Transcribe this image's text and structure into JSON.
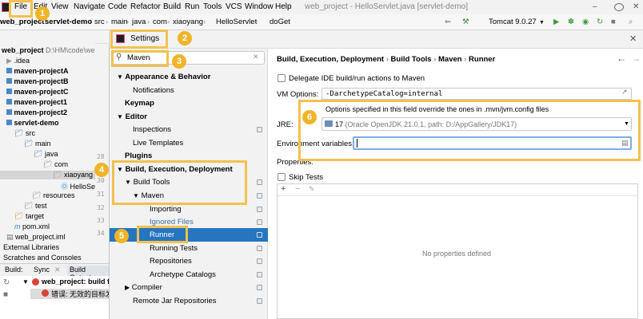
{
  "menu": {
    "items": [
      "File",
      "Edit",
      "View",
      "Navigate",
      "Code",
      "Refactor",
      "Build",
      "Run",
      "Tools",
      "VCS",
      "Window",
      "Help"
    ],
    "window_title": "web_project - HelloServlet.java [servlet-demo]"
  },
  "breadcrumb": {
    "items": [
      "web_project",
      "servlet-demo",
      "src",
      "main",
      "java",
      "com",
      "xiaoyang",
      "HelloServlet",
      "doGet"
    ],
    "run_config": "Tomcat 9.0.27"
  },
  "project_tree": {
    "root": "web_project",
    "root_path": "D:\\HM\\code\\we",
    "items": [
      ".idea",
      "maven-projectA",
      "maven-projectB",
      "maven-projectC",
      "maven-project1",
      "maven-project2",
      "servlet-demo",
      "src",
      "main",
      "java",
      "com",
      "xiaoyang",
      "HelloSe",
      "resources",
      "test",
      "target",
      "pom.xml",
      "web_project.iml",
      "External Libraries",
      "Scratches and Consoles"
    ],
    "line_numbers": [
      "28",
      "29",
      "30",
      "31",
      "32",
      "33",
      "34"
    ]
  },
  "build_panel": {
    "tabs": [
      "Build:",
      "Sync",
      "Build Output"
    ],
    "line1": "web_project: build fai",
    "line2": "错误: 无效的目标发行"
  },
  "settings": {
    "title": "Settings",
    "search_value": "Maven",
    "nav": [
      {
        "label": "Appearance & Behavior"
      },
      {
        "label": "Notifications"
      },
      {
        "label": "Keymap"
      },
      {
        "label": "Editor"
      },
      {
        "label": "Inspections"
      },
      {
        "label": "Live Templates"
      },
      {
        "label": "Plugins"
      },
      {
        "label": "Build, Execution, Deployment"
      },
      {
        "label": "Build Tools"
      },
      {
        "label": "Maven"
      },
      {
        "label": "Importing"
      },
      {
        "label": "Ignored Files"
      },
      {
        "label": "Runner"
      },
      {
        "label": "Running Tests"
      },
      {
        "label": "Repositories"
      },
      {
        "label": "Archetype Catalogs"
      },
      {
        "label": "Compiler"
      },
      {
        "label": "Remote Jar Repositories"
      }
    ],
    "crumbs": [
      "Build, Execution, Deployment",
      "Build Tools",
      "Maven",
      "Runner"
    ],
    "delegate_label": "Delegate IDE build/run actions to Maven",
    "vm_options_label": "VM Options:",
    "vm_options_value": "-DarchetypeCatalog=internal",
    "override_note": "Options specified in this field override the ones in .mvn/jvm.config files",
    "jre_label": "JRE:",
    "jre_version": "17",
    "jre_detail": "(Oracle OpenJDK 21.0.1, path: D:/AppGallery/JDK17)",
    "env_label": "Environment variables:",
    "properties_label": "Properties:",
    "skip_tests_label": "Skip Tests",
    "empty_text": "No properties defined"
  },
  "callouts": [
    "1",
    "2",
    "3",
    "4",
    "5",
    "6"
  ],
  "colors": {
    "accent": "#f2c14e",
    "selection": "#2675bf",
    "badge": "#f0b429"
  }
}
